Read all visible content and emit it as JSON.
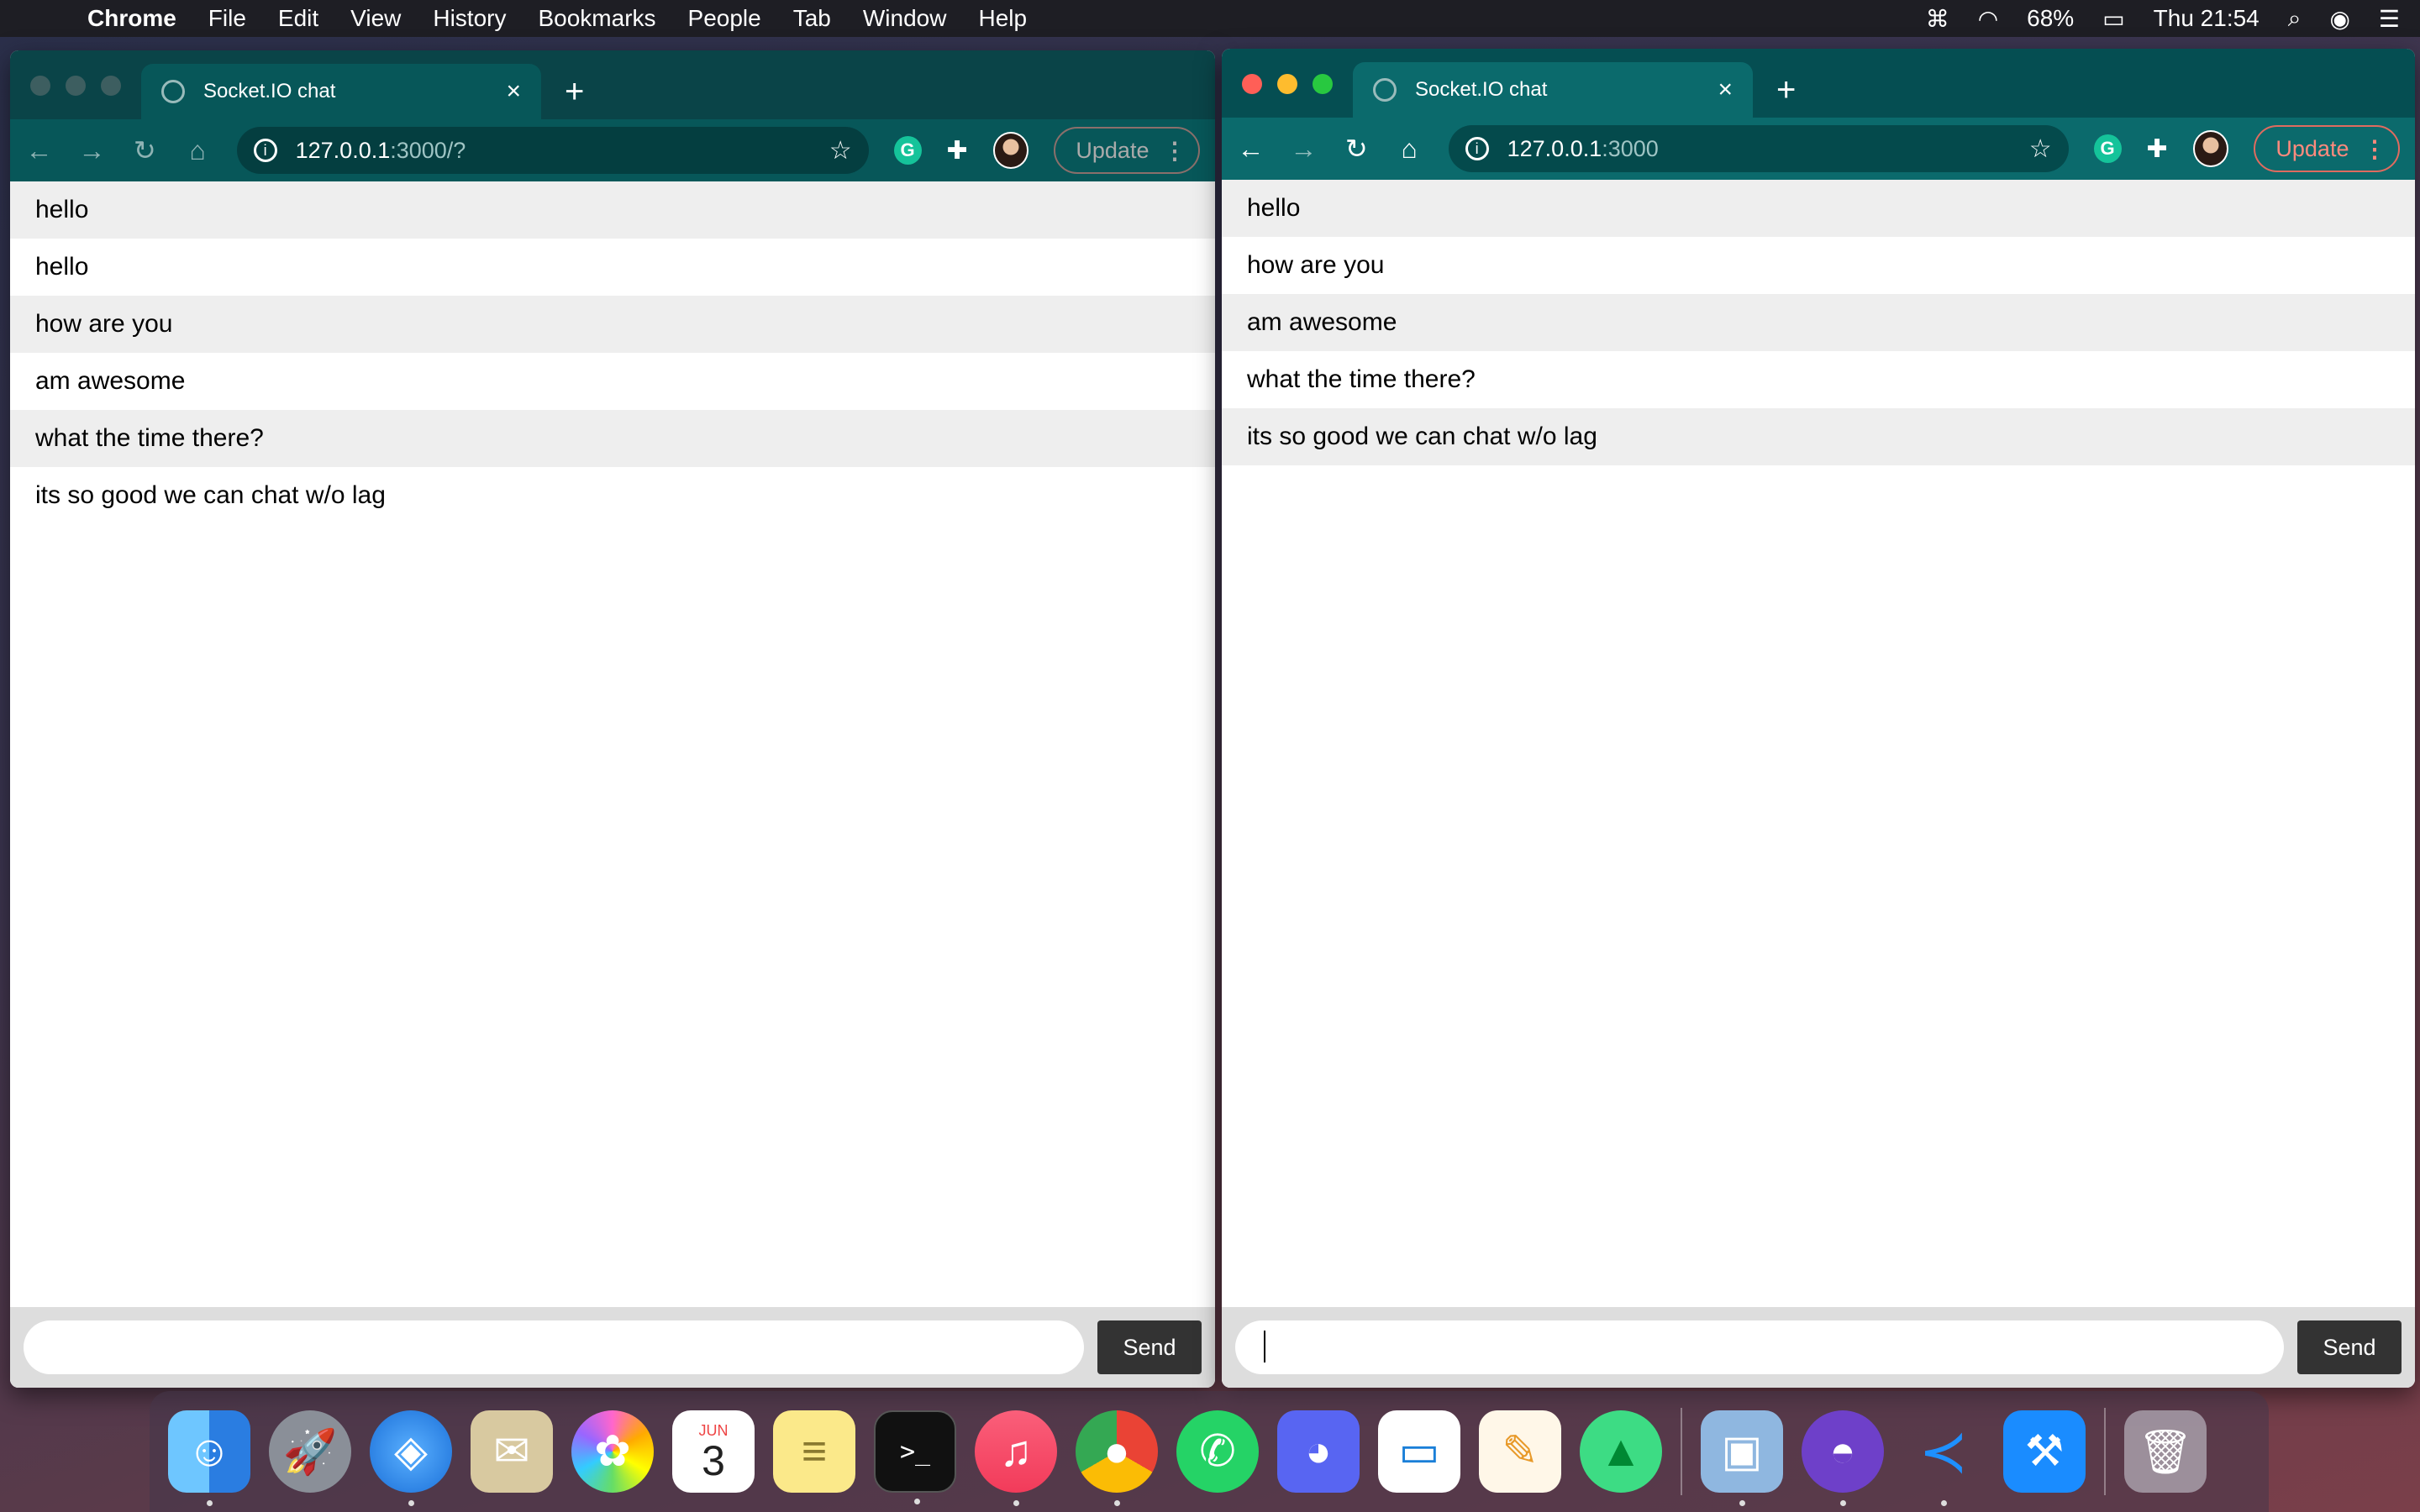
{
  "menubar": {
    "app_name": "Chrome",
    "items": [
      "File",
      "Edit",
      "View",
      "History",
      "Bookmarks",
      "People",
      "Tab",
      "Window",
      "Help"
    ],
    "battery": "68%",
    "clock": "Thu 21:54"
  },
  "windows": [
    {
      "tab_title": "Socket.IO chat",
      "url_host": "127.0.0.1",
      "url_path": ":3000/?",
      "update_label": "Update",
      "messages": [
        "hello",
        "hello",
        "how are you",
        "am awesome",
        "what the time there?",
        "its so good we can chat w/o lag"
      ],
      "input_value": "",
      "send_label": "Send"
    },
    {
      "tab_title": "Socket.IO chat",
      "url_host": "127.0.0.1",
      "url_path": ":3000",
      "update_label": "Update",
      "messages": [
        "hello",
        "how are you",
        "am awesome",
        "what the time there?",
        "its so good we can chat w/o lag"
      ],
      "input_value": "",
      "send_label": "Send"
    }
  ],
  "dock": {
    "calendar_month": "JUN",
    "calendar_day": "3",
    "apps": [
      "finder",
      "launchpad",
      "safari",
      "mail",
      "photos",
      "calendar",
      "notes",
      "terminal",
      "music",
      "chrome",
      "whatsapp",
      "discord",
      "keynote",
      "pages",
      "android-studio",
      "preview",
      "github-desktop",
      "vscode",
      "xcode",
      "trash"
    ]
  }
}
